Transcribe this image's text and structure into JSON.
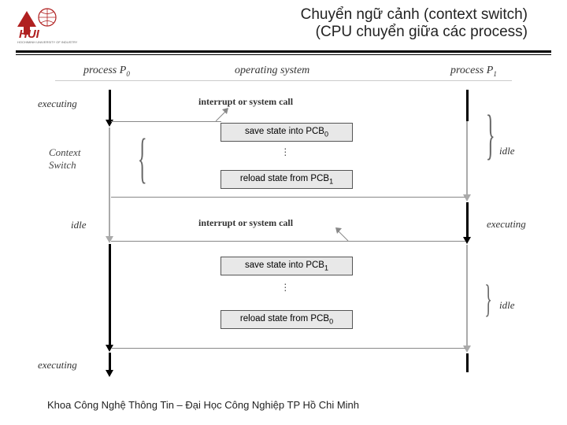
{
  "header": {
    "title_line1": "Chuyển ngữ cảnh (context switch)",
    "title_line2": "(CPU chuyển giữa các process)"
  },
  "columns": {
    "p0": "process P",
    "p0_sub": "0",
    "os": "operating system",
    "p1": "process P",
    "p1_sub": "1"
  },
  "labels": {
    "executing": "executing",
    "idle": "idle",
    "interrupt": "interrupt or system call",
    "save_pcb0": "save state into PCB",
    "save_pcb0_sub": "0",
    "reload_pcb1": "reload state from PCB",
    "reload_pcb1_sub": "1",
    "save_pcb1": "save state into PCB",
    "save_pcb1_sub": "1",
    "reload_pcb0": "reload state from PCB",
    "reload_pcb0_sub": "0",
    "context_switch1": "Context",
    "context_switch2": "Switch"
  },
  "footer": "Khoa Công Nghệ Thông Tin – Đại Học Công Nghiệp TP Hồ Chi Minh"
}
